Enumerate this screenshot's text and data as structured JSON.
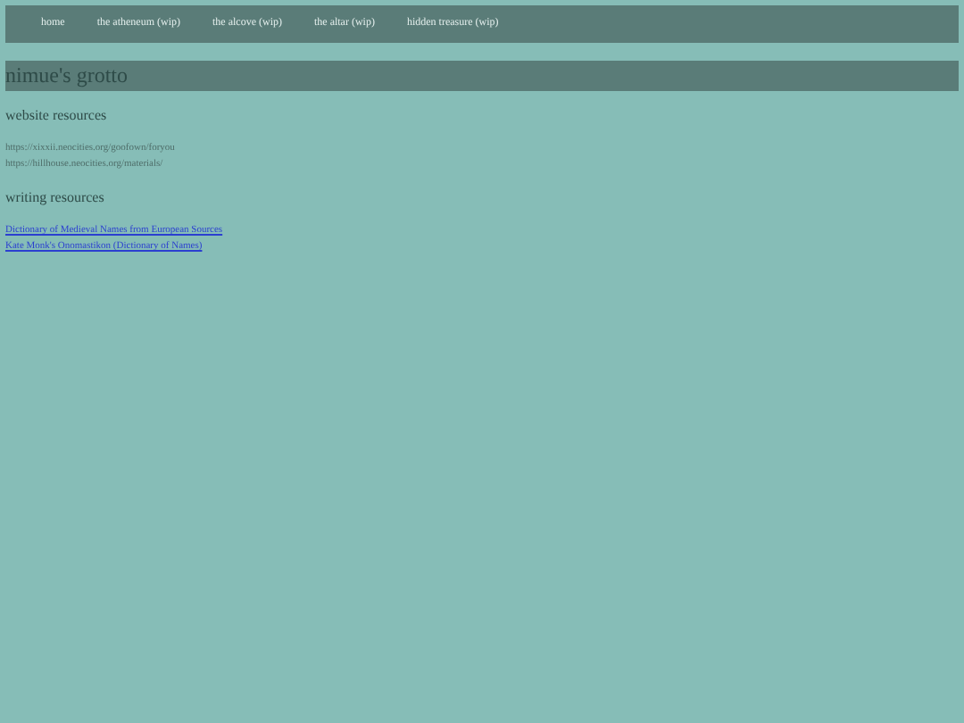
{
  "nav": [
    {
      "label": "home"
    },
    {
      "label": "the atheneum (wip)"
    },
    {
      "label": "the alcove (wip)"
    },
    {
      "label": "the altar (wip)"
    },
    {
      "label": "hidden treasure (wip)"
    }
  ],
  "title": "nimue's grotto",
  "sections": [
    {
      "heading": "website resources",
      "items": [
        {
          "kind": "text",
          "text": "https://xixxii.neocities.org/goofown/foryou"
        },
        {
          "kind": "text",
          "text": "https://hillhouse.neocities.org/materials/"
        }
      ]
    },
    {
      "heading": "writing resources",
      "items": [
        {
          "kind": "link",
          "text": "Dictionary of Medieval Names from European Sources"
        },
        {
          "kind": "link",
          "text": "Kate Monk's Onomastikon (Dictionary of Names)"
        }
      ]
    }
  ]
}
